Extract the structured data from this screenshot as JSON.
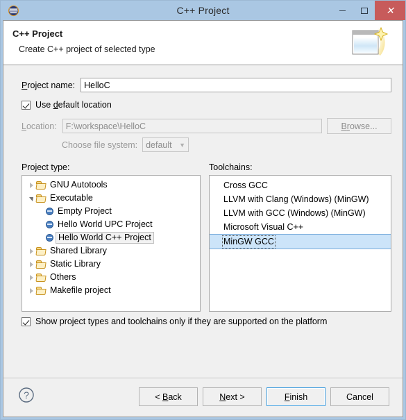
{
  "window": {
    "title": "C++ Project",
    "app_icon": "eclipse-icon",
    "controls": {
      "minimize": "minimize-icon",
      "maximize": "maximize-icon",
      "close": "close-icon",
      "close_color": "#c75b5b"
    },
    "frame_color": "#aac7e3",
    "body_color": "#f0f0f0"
  },
  "header": {
    "title": "C++ Project",
    "subtitle": "Create C++ project of selected type",
    "graphic": "wizard-window-sparkle-icon"
  },
  "form": {
    "project_name": {
      "label_pre": "P",
      "label_post": "roject name:",
      "value": "HelloC"
    },
    "use_default_location": {
      "label_pre": "Use ",
      "label_mnemonic": "d",
      "label_post": "efault location",
      "checked": true
    },
    "location": {
      "label_pre": "L",
      "label_post": "ocation:",
      "value": "F:\\workspace\\HelloC",
      "disabled": true
    },
    "browse": {
      "label_pre": "B",
      "label_mnemonic": "r",
      "label_post": "owse...",
      "disabled": true
    },
    "file_system": {
      "label_pre": "Choose file s",
      "label_mnemonic": "y",
      "label_post": "stem:",
      "value": "default",
      "chevron": "chevron-down-icon",
      "disabled": true
    }
  },
  "project_type": {
    "label": "Project type:",
    "items": [
      {
        "label": "GNU Autotools",
        "kind": "folder",
        "state": "collapsed",
        "depth": 0,
        "selected": false
      },
      {
        "label": "Executable",
        "kind": "folder",
        "state": "expanded",
        "depth": 0,
        "selected": false
      },
      {
        "label": "Empty Project",
        "kind": "leaf",
        "state": "none",
        "depth": 1,
        "selected": false
      },
      {
        "label": "Hello World UPC Project",
        "kind": "leaf",
        "state": "none",
        "depth": 1,
        "selected": false
      },
      {
        "label": "Hello World C++ Project",
        "kind": "leaf",
        "state": "none",
        "depth": 1,
        "selected": true
      },
      {
        "label": "Shared Library",
        "kind": "folder",
        "state": "collapsed",
        "depth": 0,
        "selected": false
      },
      {
        "label": "Static Library",
        "kind": "folder",
        "state": "collapsed",
        "depth": 0,
        "selected": false
      },
      {
        "label": "Others",
        "kind": "folder",
        "state": "collapsed",
        "depth": 0,
        "selected": false
      },
      {
        "label": "Makefile project",
        "kind": "folder",
        "state": "collapsed",
        "depth": 0,
        "selected": false
      }
    ]
  },
  "toolchains": {
    "label": "Toolchains:",
    "items": [
      {
        "label": "Cross GCC",
        "selected": false
      },
      {
        "label": "LLVM with Clang (Windows) (MinGW)",
        "selected": false
      },
      {
        "label": "LLVM with GCC (Windows) (MinGW)",
        "selected": false
      },
      {
        "label": "Microsoft Visual C++",
        "selected": false
      },
      {
        "label": "MinGW GCC",
        "selected": true
      }
    ],
    "selection_color": "#cce4f9"
  },
  "show_supported": {
    "label": "Show project types and toolchains only if they are supported on the platform",
    "checked": true
  },
  "footer": {
    "help_icon": "help-question-icon",
    "buttons": [
      {
        "name": "back",
        "pre": "< ",
        "mnemonic": "B",
        "post": "ack",
        "default": false
      },
      {
        "name": "next",
        "pre": "",
        "mnemonic": "N",
        "post": "ext >",
        "default": false
      },
      {
        "name": "finish",
        "pre": "",
        "mnemonic": "F",
        "post": "inish",
        "default": true
      },
      {
        "name": "cancel",
        "pre": "Cancel",
        "mnemonic": "",
        "post": "",
        "default": false
      }
    ],
    "default_border_color": "#3c9bdd"
  }
}
